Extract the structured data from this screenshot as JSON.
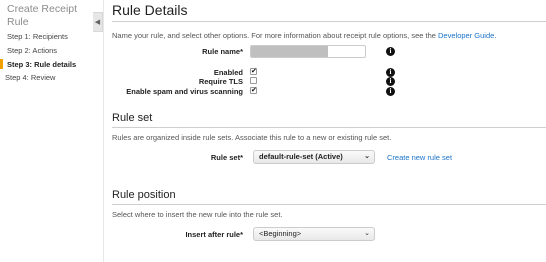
{
  "sidebar": {
    "title": "Create Receipt Rule",
    "steps": [
      {
        "label": "Step 1: Recipients"
      },
      {
        "label": "Step 2: Actions"
      },
      {
        "label": "Step 3: Rule details"
      },
      {
        "label": "Step 4: Review"
      }
    ],
    "active_step_index": 2,
    "collapse_glyph": "◀"
  },
  "colors": {
    "accent": "#f0a100",
    "link": "#1a73c8"
  },
  "rule_details": {
    "title": "Rule Details",
    "intro": "Name your rule, and select other options. For more information about receipt rule options, see the ",
    "intro_link": "Developer Guide",
    "intro_end": ".",
    "rule_name_label": "Rule name*",
    "rule_name_value": "",
    "enabled_label": "Enabled",
    "enabled_checked": "✔",
    "require_tls_label": "Require TLS",
    "spam_label": "Enable spam and virus scanning",
    "spam_checked": "✔",
    "info_glyph": "i"
  },
  "rule_set": {
    "title": "Rule set",
    "desc": "Rules are organized inside rule sets. Associate this rule to a new or existing rule set.",
    "label": "Rule set*",
    "selected": "default-rule-set (Active)",
    "create_link": "Create new rule set"
  },
  "rule_position": {
    "title": "Rule position",
    "desc": "Select where to insert the new rule into the rule set.",
    "label": "Insert after rule*",
    "selected": "<Beginning>"
  },
  "chevron_glyph": "⌄"
}
